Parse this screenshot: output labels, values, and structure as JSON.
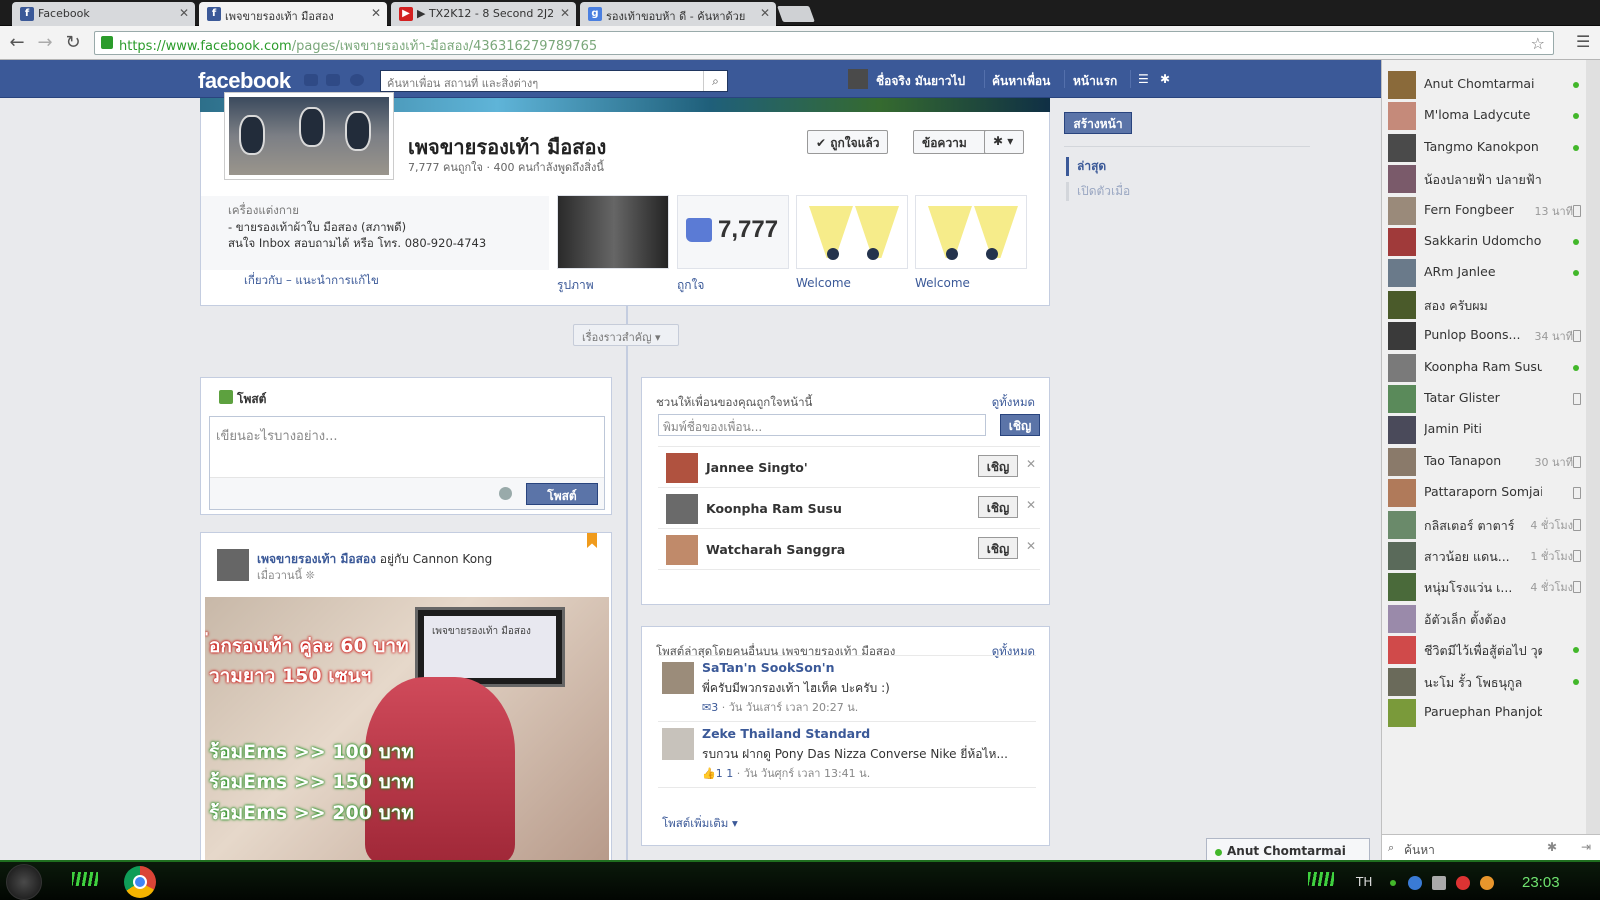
{
  "browser": {
    "tabs": [
      {
        "title": "Facebook",
        "icon": "facebook-icon",
        "active": false
      },
      {
        "title": "เพจขายรองเท้า มือสอง",
        "icon": "facebook-icon",
        "active": true
      },
      {
        "title": "▶ TX2K12 - 8 Second 2J2",
        "icon": "youtube-icon",
        "active": false
      },
      {
        "title": "รองเท้าขอบห้า ดี - ค้นหาด้วย",
        "icon": "google-icon",
        "active": false
      }
    ],
    "url_host": "https://www.facebook.com",
    "url_path": "/pages/เพจขายรองเท้า-มือสอง/436316279789765"
  },
  "fb": {
    "logo": "facebook",
    "search_placeholder": "ค้นหาเพื่อน สถานที่ และสิ่งต่างๆ",
    "user_name": "ชื่อจริง มันยาวไป",
    "nav_find_friends": "ค้นหาเพื่อน",
    "nav_home": "หน้าแรก"
  },
  "page": {
    "name": "เพจขายรองเท้า มือสอง",
    "stats": "7,777 คนถูกใจ · 400 คนกำลังพูดถึงสิ่งนี้",
    "liked_button": "✔ ถูกใจแล้ว",
    "message_button": "ข้อความ",
    "about_category": "เครื่องแต่งกาย",
    "about_line1": "- ขายรองเท้าผ้าใบ มือสอง (สภาพดี)",
    "about_line2": "สนใจ Inbox สอบถามได้ หรือ โทร. 080-920-4743",
    "about_link": "เกี่ยวกับ – แนะนำการแก้ไข",
    "apps": [
      {
        "label": "รูปภาพ"
      },
      {
        "label": "ถูกใจ",
        "count": "7,777"
      },
      {
        "label": "Welcome"
      },
      {
        "label": "Welcome"
      }
    ],
    "key_stories": "เรื่องราวสำคัญ ▾"
  },
  "composer": {
    "title": "โพสต์",
    "placeholder": "เขียนอะไรบางอย่าง...",
    "post_button": "โพสต์"
  },
  "post": {
    "author": "เพจขายรองเท้า มือสอง",
    "with": " อยู่กับ Cannon Kong",
    "time": "เมื่อวานนี้ ❊",
    "laptop_text": "เพจขายรองเท้า มือสอง",
    "promo_lines": [
      "่อกรองเท้า คู่ละ 60 บาท",
      "วามยาว 150 เซนฯ",
      "ร้อมEms >> 100 บาท",
      "ร้อมEms >> 150 บาท",
      "ร้อมEms >> 200 บาท"
    ]
  },
  "invite": {
    "title": "ชวนให้เพื่อนของคุณถูกใจหน้านี้",
    "see_all": "ดูทั้งหมด",
    "input_placeholder": "พิมพ์ชื่อของเพื่อน...",
    "invite_button": "เชิญ",
    "friends": [
      {
        "name": "Jannee Singto'",
        "button": "เชิญ"
      },
      {
        "name": "Koonpha Ram Susu",
        "button": "เชิญ"
      },
      {
        "name": "Watcharah Sanggra",
        "button": "เชิญ"
      }
    ]
  },
  "recent": {
    "title": "โพสต์ล่าสุดโดยคนอื่นบน เพจขายรองเท้า มือสอง",
    "see_all": "ดูทั้งหมด",
    "posts": [
      {
        "name": "SaTan'n SookSon'n",
        "text": "พี่ครับมีพวกรองเท้า ไฮเท็ค ปะครับ :)",
        "counts": "3",
        "meta": " · วัน วันเสาร์ เวลา 20:27 น."
      },
      {
        "name": "Zeke Thailand Standard",
        "text": "รบกวน ฝากดู Pony Das Nizza Converse Nike ยี่ห้อไห...",
        "counts": "1  1",
        "meta": " · วัน วันศุกร์ เวลา 13:41 น."
      }
    ],
    "more": "โพสต์เพิ่มเติม ▾"
  },
  "right_col": {
    "create_page": "สร้างหน้า",
    "recent": "ล่าสุด",
    "joined": "เปิดตัวเมื่อ"
  },
  "chat": {
    "friends": [
      {
        "name": "Anut Chomtarmai",
        "status": "online"
      },
      {
        "name": "M'loma Ladycute",
        "status": "online"
      },
      {
        "name": "Tangmo Kanokpon",
        "status": "online"
      },
      {
        "name": "น้องปลายฟ้า ปลายฟ้า",
        "status": ""
      },
      {
        "name": "Fern Fongbeer",
        "status": "mobile",
        "time": "13 นาที"
      },
      {
        "name": "Sakkarin Udomchok",
        "status": "online"
      },
      {
        "name": "ARm Janlee",
        "status": "online"
      },
      {
        "name": "สอง ครับผม",
        "status": ""
      },
      {
        "name": "Punlop Boons...",
        "status": "mobile",
        "time": "34 นาที"
      },
      {
        "name": "Koonpha Ram Susu",
        "status": "online"
      },
      {
        "name": "Tatar Glister",
        "status": "mobile"
      },
      {
        "name": "Jamin Piti",
        "status": ""
      },
      {
        "name": "Tao Tanapon",
        "status": "mobile",
        "time": "30 นาที"
      },
      {
        "name": "Pattaraporn Somjai",
        "status": "mobile"
      },
      {
        "name": "กลิสเตอร์ ตาตาร์",
        "status": "mobile",
        "time": "4 ชั่วโมง"
      },
      {
        "name": "สาวน้อย แดน...",
        "status": "mobile",
        "time": "1 ชั่วโมง"
      },
      {
        "name": "หนุ่มโรงแว่น เ...",
        "status": "mobile",
        "time": "4 ชั่วโมง"
      },
      {
        "name": "อ้ตัวเล็ก ตั้งต้อง",
        "status": ""
      },
      {
        "name": "ชีวิตมีไว้เพื่อสู้ต่อไป วุฒิ...",
        "status": "online"
      },
      {
        "name": "นะโม รั้ว โพธนุกูล",
        "status": "online"
      },
      {
        "name": "Paruephan PhanjobSi...",
        "status": ""
      }
    ],
    "search_placeholder": "ค้นหา",
    "open_tab": "Anut Chomtarmai"
  },
  "taskbar": {
    "lang": "TH",
    "clock": "23:03"
  },
  "colors": {
    "fb_blue": "#3b5998",
    "online": "#42b72a",
    "taskbar_green": "#6fe36f"
  }
}
